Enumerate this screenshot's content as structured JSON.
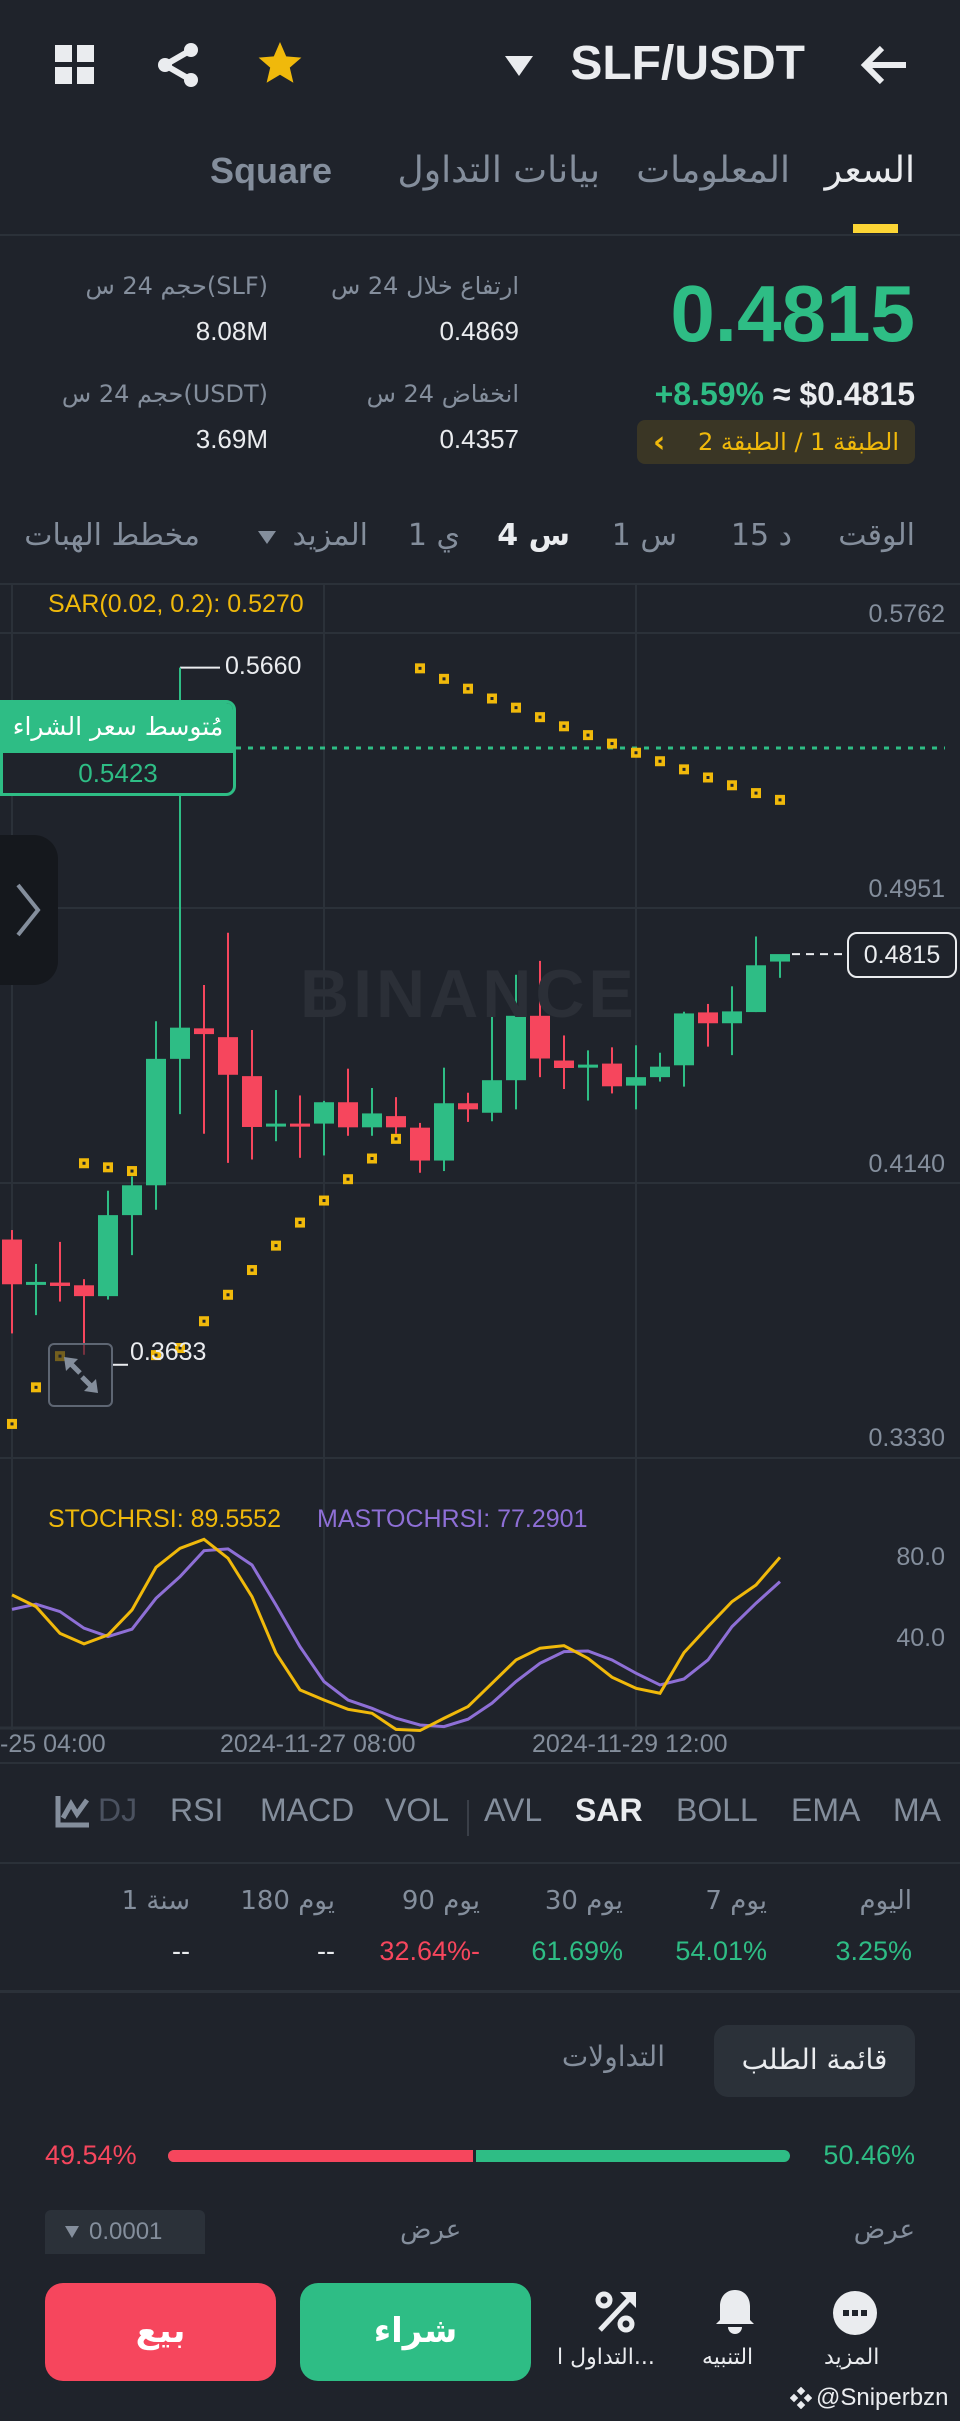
{
  "header": {
    "pair": "SLF/USDT",
    "icons": [
      "grid-icon",
      "share-icon",
      "star-icon",
      "dropdown-icon",
      "back-arrow-icon"
    ]
  },
  "tabs": [
    {
      "label": "السعر",
      "active": true
    },
    {
      "label": "المعلومات"
    },
    {
      "label": "بيانات التداول"
    },
    {
      "label": "Square"
    }
  ],
  "ticker": {
    "price": "0.4815",
    "change": "+8.59%",
    "usd": "≈ $0.4815",
    "tier": "الطبقة 1 / الطبقة 2",
    "tier_chevron": "‹",
    "high_label": "ارتفاع خلال 24 س",
    "high": "0.4869",
    "low_label": "انخفاض 24 س",
    "low": "0.4357",
    "vol_base_label": "حجم 24 س(SLF)",
    "vol_base": "8.08M",
    "vol_quote_label": "حجم 24 س(USDT)",
    "vol_quote": "3.69M"
  },
  "intervals": {
    "time": "الوقت",
    "items": [
      "15 د",
      "1 س",
      "4 س",
      "1 ي"
    ],
    "active": "4 س",
    "more": "المزيد",
    "chart": "مخطط الهبات"
  },
  "chart": {
    "sar_label": "SAR(0.02, 0.2): 0.5270",
    "axis": [
      "0.5762",
      "0.4951",
      "0.4140",
      "0.3330"
    ],
    "high_marker": "0.5660",
    "low_marker": "0.3633",
    "avg_buy_label": "مُتوسط سعر الشراء",
    "avg_buy": "0.5423",
    "last_price": "0.4815",
    "watermark": "BINANCE",
    "stoch_label": "STOCHRSI: 89.5552",
    "mastoch_label": "MASTOCHRSI: 77.2901",
    "stoch_axis": [
      "80.0",
      "40.0"
    ],
    "dates": [
      "-25 04:00",
      "2024-11-27 08:00",
      "2024-11-29 12:00"
    ]
  },
  "chart_data": {
    "type": "candlestick",
    "colors": {
      "up": "#2ebd85",
      "down": "#f6465d",
      "sar": "#f0b90b",
      "stoch": "#f0b90b",
      "mastoch": "#8e6fd6"
    },
    "ohlc": [
      [
        0.3973,
        0.4001,
        0.3696,
        0.3841
      ],
      [
        0.3841,
        0.3901,
        0.375,
        0.3848
      ],
      [
        0.3846,
        0.3966,
        0.379,
        0.3836
      ],
      [
        0.3838,
        0.3856,
        0.3633,
        0.3806
      ],
      [
        0.3806,
        0.4117,
        0.3796,
        0.4045
      ],
      [
        0.4045,
        0.4159,
        0.3927,
        0.4133
      ],
      [
        0.4133,
        0.4617,
        0.4061,
        0.4506
      ],
      [
        0.4506,
        0.566,
        0.4343,
        0.4598
      ],
      [
        0.4596,
        0.4724,
        0.4285,
        0.4579
      ],
      [
        0.457,
        0.4878,
        0.4199,
        0.4459
      ],
      [
        0.4455,
        0.4591,
        0.4209,
        0.4305
      ],
      [
        0.4308,
        0.4414,
        0.4263,
        0.4315
      ],
      [
        0.4315,
        0.4398,
        0.4214,
        0.4306
      ],
      [
        0.4315,
        0.4382,
        0.4221,
        0.4378
      ],
      [
        0.4378,
        0.4477,
        0.4279,
        0.4304
      ],
      [
        0.4304,
        0.442,
        0.4279,
        0.4345
      ],
      [
        0.4337,
        0.4393,
        0.4285,
        0.4304
      ],
      [
        0.4303,
        0.4317,
        0.417,
        0.4206
      ],
      [
        0.4206,
        0.448,
        0.4175,
        0.4375
      ],
      [
        0.4375,
        0.4406,
        0.432,
        0.4357
      ],
      [
        0.4347,
        0.4752,
        0.4322,
        0.4443
      ],
      [
        0.4443,
        0.4754,
        0.4357,
        0.4633
      ],
      [
        0.4633,
        0.4795,
        0.4452,
        0.4507
      ],
      [
        0.4501,
        0.4575,
        0.4417,
        0.4479
      ],
      [
        0.448,
        0.4531,
        0.4383,
        0.4489
      ],
      [
        0.4492,
        0.454,
        0.4404,
        0.4425
      ],
      [
        0.4427,
        0.4546,
        0.4357,
        0.4452
      ],
      [
        0.4452,
        0.4524,
        0.4439,
        0.4483
      ],
      [
        0.4487,
        0.4645,
        0.4424,
        0.464
      ],
      [
        0.4643,
        0.4668,
        0.4542,
        0.4611
      ],
      [
        0.4611,
        0.472,
        0.4517,
        0.4646
      ],
      [
        0.4644,
        0.4867,
        0.4644,
        0.4782
      ],
      [
        0.4793,
        0.4812,
        0.4745,
        0.4815
      ]
    ],
    "sar": [
      0.3429,
      0.3537,
      0.3629,
      0.4198,
      0.4186,
      0.4175,
      0.3632,
      0.3653,
      0.3732,
      0.381,
      0.3883,
      0.3955,
      0.4023,
      0.4088,
      0.4151,
      0.4212,
      0.427,
      0.5658,
      0.5627,
      0.5598,
      0.5569,
      0.5542,
      0.5514,
      0.5487,
      0.5461,
      0.5436,
      0.5409,
      0.5384,
      0.536,
      0.5336,
      0.5313,
      0.529,
      0.527
    ],
    "stochrsi": [
      70.6,
      64.7,
      51.2,
      45.9,
      50.4,
      63.0,
      84.5,
      94.1,
      98.6,
      89.1,
      69.7,
      41.2,
      22.7,
      17.6,
      12.9,
      10.9,
      2.8,
      2.2,
      8.4,
      14.3,
      26.0,
      37.8,
      43.7,
      45.0,
      38.6,
      29.1,
      23.5,
      21.0,
      41.5,
      54.6,
      67.2,
      75.6,
      89.56
    ],
    "mastochrsi": [
      63.3,
      65.9,
      62.2,
      53.8,
      49.6,
      53.3,
      68.9,
      79.8,
      92.9,
      93.8,
      85.7,
      65.5,
      44.5,
      26.9,
      17.6,
      13.4,
      8.4,
      5.0,
      4.2,
      7.9,
      16.0,
      26.9,
      36.1,
      42.0,
      42.3,
      37.8,
      31.1,
      25.2,
      28.2,
      37.8,
      54.6,
      66.4,
      77.29
    ],
    "ylim": [
      0.333,
      0.5762
    ],
    "avg_buy": 0.5423,
    "last": 0.4815
  },
  "indicators": {
    "items": [
      "MA",
      "EMA",
      "BOLL",
      "SAR",
      "AVL",
      "VOL",
      "MACD",
      "RSI",
      "DJ"
    ],
    "active": "SAR"
  },
  "performance": [
    {
      "label": "اليوم",
      "value": "3.25%",
      "dir": "up"
    },
    {
      "label": "7 يوم",
      "value": "54.01%",
      "dir": "up"
    },
    {
      "label": "30 يوم",
      "value": "61.69%",
      "dir": "up"
    },
    {
      "label": "90 يوم",
      "value": "32.64%-",
      "dir": "down"
    },
    {
      "label": "180 يوم",
      "value": "--"
    },
    {
      "label": "1 سنة",
      "value": "--"
    }
  ],
  "orderbook": {
    "tab_active": "قائمة الطلب",
    "tab_trades": "التداولات",
    "bid_pct": "50.46%",
    "ask_pct": "49.54%",
    "bid_ratio": 0.5046,
    "bid_label": "عرض",
    "ask_label": "عرض",
    "precision": "0.0001"
  },
  "actions": {
    "more": "المزيد",
    "alert": "التنبيه",
    "trade": "التداول ا...",
    "buy": "شراء",
    "sell": "بيع"
  },
  "watermark": "@Sniperbzn"
}
